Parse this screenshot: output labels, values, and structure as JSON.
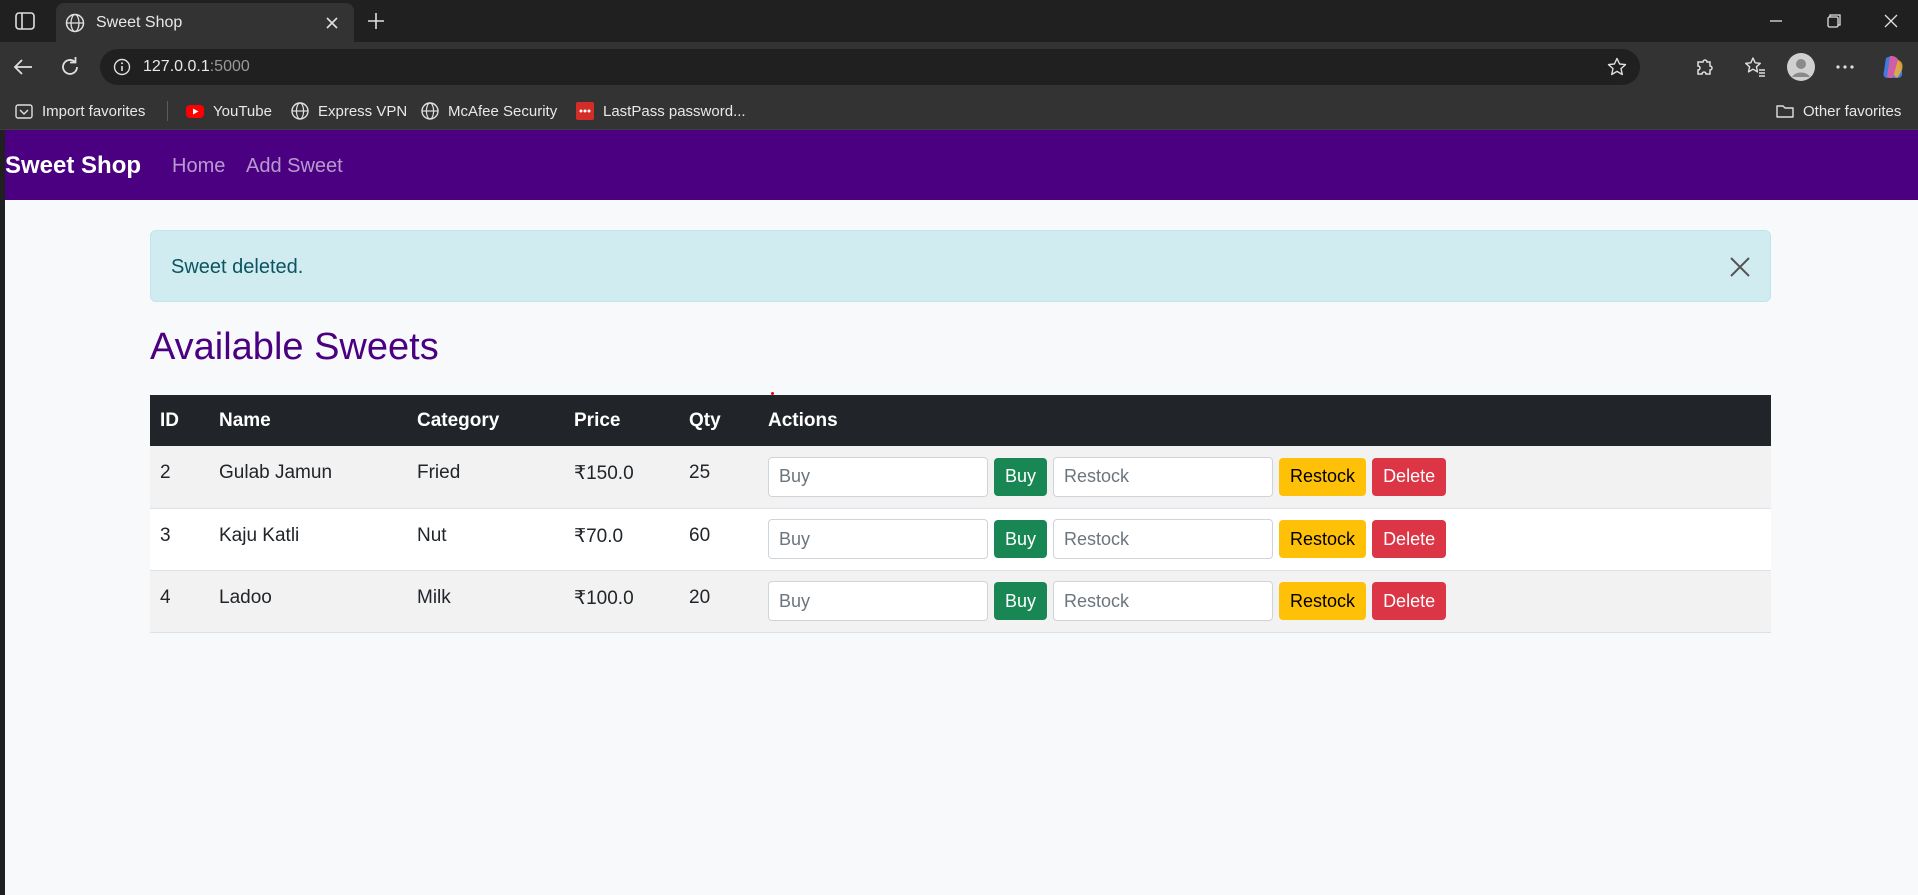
{
  "browser": {
    "tab_title": "Sweet Shop",
    "url_host": "127.0.0.1",
    "url_port": ":5000",
    "bookmarks": [
      {
        "label": "Import favorites",
        "icon": "import-icon"
      },
      {
        "label": "YouTube",
        "icon": "youtube-icon"
      },
      {
        "label": "Express VPN",
        "icon": "globe-icon"
      },
      {
        "label": "McAfee Security",
        "icon": "globe-icon"
      },
      {
        "label": "LastPass password...",
        "icon": "lastpass-icon"
      }
    ],
    "other_favorites": "Other favorites"
  },
  "navbar": {
    "brand": "Sweet Shop",
    "links": [
      "Home",
      "Add Sweet"
    ]
  },
  "alert": {
    "message": "Sweet deleted."
  },
  "page_title": "Available Sweets",
  "table": {
    "headers": [
      "ID",
      "Name",
      "Category",
      "Price",
      "Qty",
      "Actions"
    ],
    "rows": [
      {
        "id": "2",
        "name": "Gulab Jamun",
        "category": "Fried",
        "price": "₹150.0",
        "qty": "25"
      },
      {
        "id": "3",
        "name": "Kaju Katli",
        "category": "Nut",
        "price": "₹70.0",
        "qty": "60"
      },
      {
        "id": "4",
        "name": "Ladoo",
        "category": "Milk",
        "price": "₹100.0",
        "qty": "20"
      }
    ]
  },
  "actions": {
    "buy_placeholder": "Buy",
    "buy_label": "Buy",
    "restock_placeholder": "Restock",
    "restock_label": "Restock",
    "delete_label": "Delete"
  },
  "colors": {
    "navbar": "#4b0082",
    "heading": "#4b0082",
    "alert_bg": "#d1ecf1",
    "buy": "#198754",
    "restock": "#ffc107",
    "delete": "#dc3545"
  }
}
